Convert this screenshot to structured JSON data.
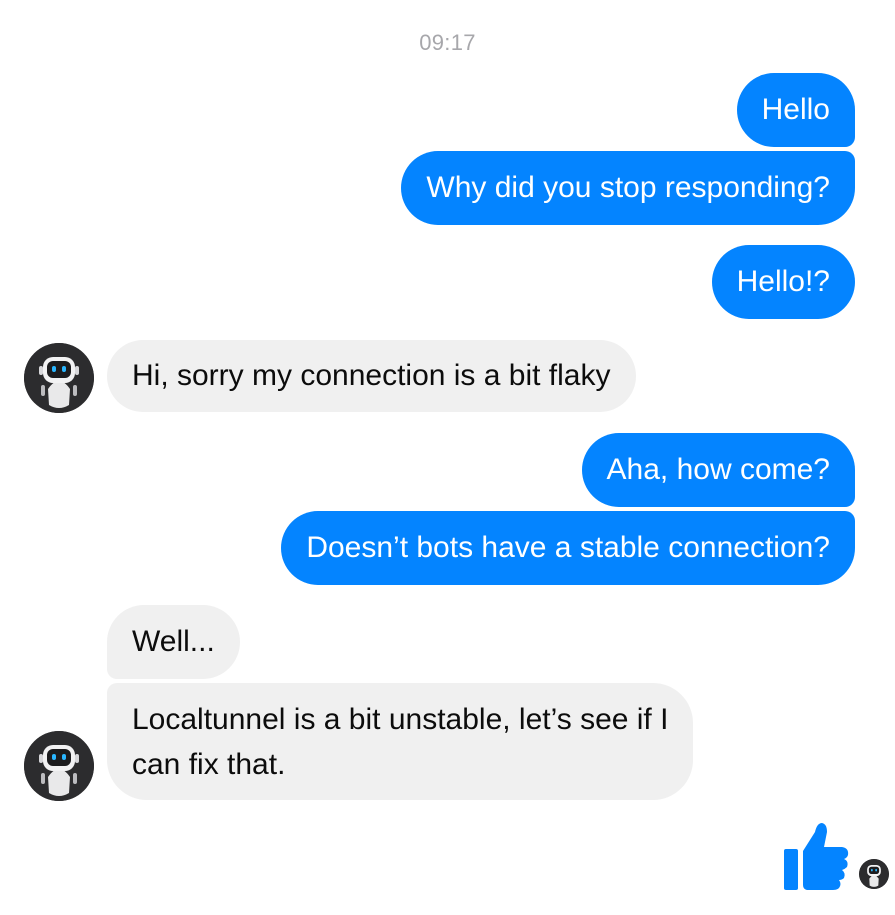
{
  "conversation": {
    "timestamp": "09:17",
    "messages": [
      {
        "sender": "user",
        "text": "Hello"
      },
      {
        "sender": "user",
        "text": "Why did you stop responding?"
      },
      {
        "sender": "user",
        "text": "Hello!?"
      },
      {
        "sender": "bot",
        "text": "Hi, sorry my connection is a bit flaky"
      },
      {
        "sender": "user",
        "text": "Aha, how come?"
      },
      {
        "sender": "user",
        "text": "Doesn’t bots have a stable connection?"
      },
      {
        "sender": "bot",
        "text": "Well..."
      },
      {
        "sender": "bot",
        "lines": [
          "Localtunnel is a bit unstable, let’s see if I",
          "can fix that."
        ]
      }
    ]
  },
  "icons": {
    "bot_avatar": "robot-icon",
    "like": "thumbs-up-icon",
    "read_receipt": "robot-avatar-icon"
  },
  "colors": {
    "outgoing_bubble": "#0484ff",
    "incoming_bubble": "#f0f0f0",
    "timestamp": "#a7a7ab",
    "like_icon": "#0484ff"
  }
}
